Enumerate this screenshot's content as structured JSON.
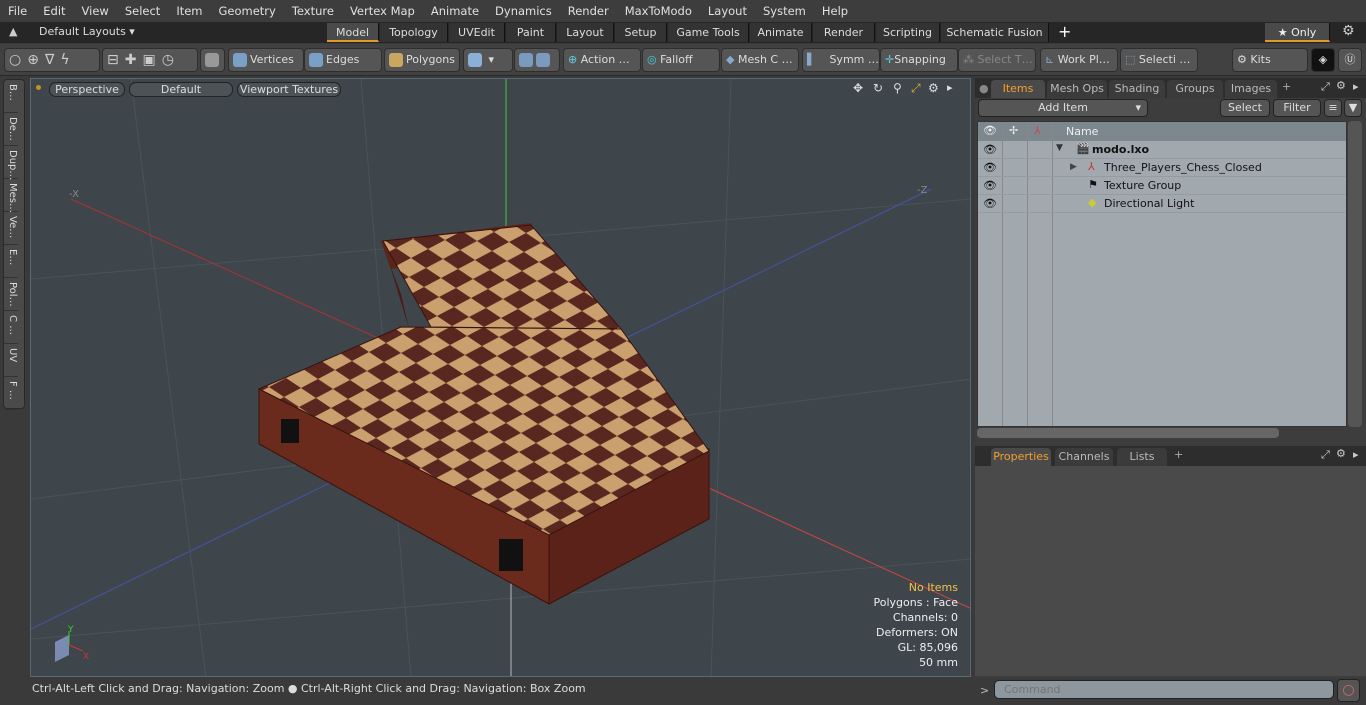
{
  "menu": [
    "File",
    "Edit",
    "View",
    "Select",
    "Item",
    "Geometry",
    "Texture",
    "Vertex Map",
    "Animate",
    "Dynamics",
    "Render",
    "MaxToModo",
    "Layout",
    "System",
    "Help"
  ],
  "layouts": {
    "selector": "Default Layouts ▾",
    "tabs": [
      "Model",
      "Topology",
      "UVEdit",
      "Paint",
      "Layout",
      "Setup",
      "Game Tools",
      "Animate",
      "Render",
      "Scripting",
      "Schematic Fusion"
    ],
    "active": "Model",
    "add": "+",
    "only": "★ Only"
  },
  "toolbar": {
    "vertices": "Vertices",
    "edges": "Edges",
    "polygons": "Polygons",
    "action": "Action  …",
    "falloff": "Falloff",
    "mesh": "Mesh C …",
    "symm": "Symm …",
    "snapping": "Snapping",
    "select_t": "Select T…",
    "workplane": "Work Pl…",
    "selection": "Selecti …",
    "kits": "Kits"
  },
  "left_tabs": [
    "B…",
    "De…",
    "Dup…",
    "Mes…",
    "Ve…",
    "E…",
    "Pol…",
    "C …",
    "UV",
    "F …"
  ],
  "viewport": {
    "perspective": "Perspective",
    "default": "Default",
    "textures": "Viewport Textures",
    "hud": {
      "selection": "No Items",
      "polygons": "Polygons : Face",
      "channels": "Channels: 0",
      "deformers": "Deformers: ON",
      "gl": "GL: 85,096",
      "size": "50 mm"
    },
    "axis_labels": {
      "x": "X",
      "y": "Y",
      "neg_x": "-X",
      "neg_z": "-Z"
    }
  },
  "status": "Ctrl-Alt-Left Click and Drag: Navigation: Zoom ● Ctrl-Alt-Right Click and Drag: Navigation: Box Zoom",
  "items_panel": {
    "tabs": [
      "Items",
      "Mesh Ops",
      "Shading",
      "Groups",
      "Images"
    ],
    "active": "Items",
    "add_item": "Add Item",
    "select": "Select",
    "filter": "Filter",
    "name_header": "Name",
    "rows": [
      {
        "name": "modo.lxo",
        "bold": true
      },
      {
        "name": "Three_Players_Chess_Closed"
      },
      {
        "name": "Texture Group"
      },
      {
        "name": "Directional Light"
      }
    ]
  },
  "properties_panel": {
    "tabs": [
      "Properties",
      "Channels",
      "Lists"
    ],
    "active": "Properties"
  },
  "command": {
    "prompt": ">",
    "placeholder": "Command"
  },
  "colors": {
    "accent": "#e09a2a",
    "viewport_bg": "#3e464b",
    "hud_highlight": "#f5c24a",
    "board_dark": "#5a2620",
    "board_light": "#c8a070"
  }
}
